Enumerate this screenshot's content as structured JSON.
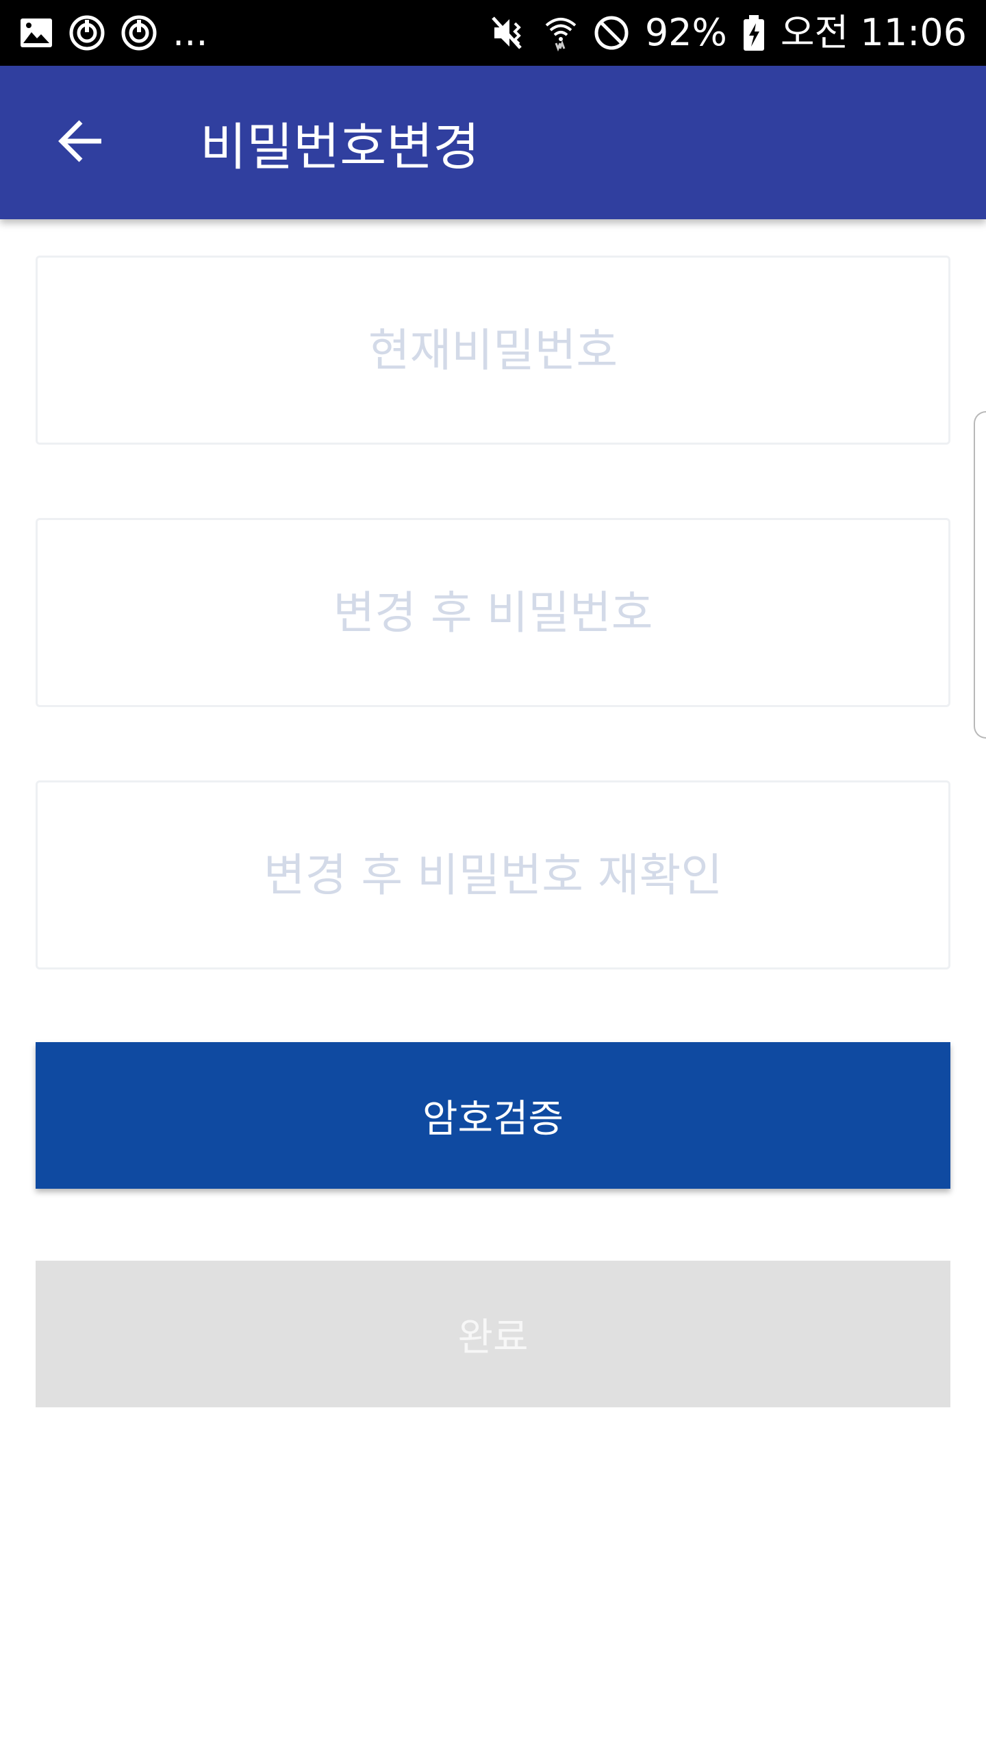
{
  "status_bar": {
    "ellipsis": "...",
    "battery_percent": "92%",
    "time": "오전 11:06",
    "icons": [
      "image-icon",
      "sync-icon",
      "sync-icon",
      "mute-vibrate-icon",
      "wifi-icon",
      "do-not-disturb-icon",
      "battery-charging-icon"
    ]
  },
  "app_bar": {
    "title": "비밀번호변경",
    "back_icon": "arrow-back-icon",
    "color": "#303f9f"
  },
  "form": {
    "current_password_placeholder": "현재비밀번호",
    "new_password_placeholder": "변경 후 비밀번호",
    "confirm_password_placeholder": "변경 후 비밀번호 재확인"
  },
  "buttons": {
    "verify_label": "암호검증",
    "verify_color": "#0f4aa1",
    "done_label": "완료",
    "done_color": "#e0e0e0"
  }
}
